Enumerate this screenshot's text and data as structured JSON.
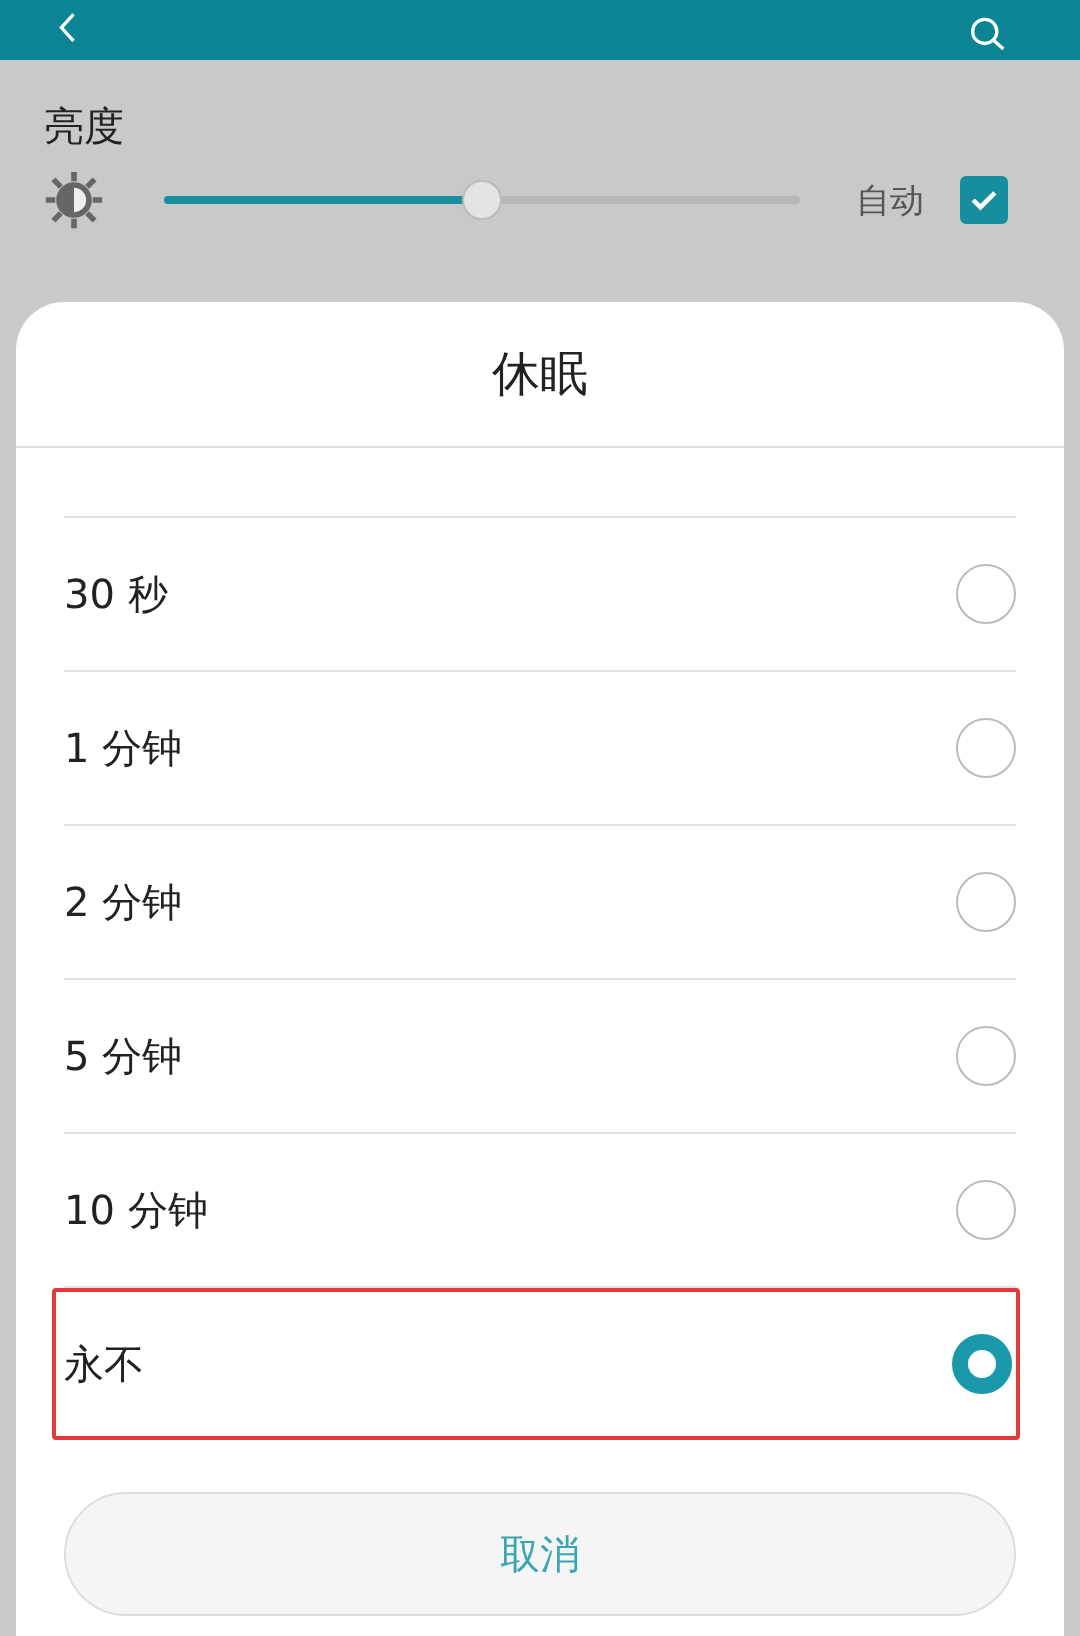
{
  "brightness": {
    "label": "亮度",
    "level": 0.5,
    "auto_label": "自动",
    "auto_checked": true
  },
  "dialog": {
    "title": "休眠",
    "options": [
      {
        "label": "30 秒",
        "selected": false,
        "highlighted": false
      },
      {
        "label": "1 分钟",
        "selected": false,
        "highlighted": false
      },
      {
        "label": "2 分钟",
        "selected": false,
        "highlighted": false
      },
      {
        "label": "5 分钟",
        "selected": false,
        "highlighted": false
      },
      {
        "label": "10 分钟",
        "selected": false,
        "highlighted": false
      },
      {
        "label": "永不",
        "selected": true,
        "highlighted": true
      }
    ],
    "cancel": "取消"
  }
}
